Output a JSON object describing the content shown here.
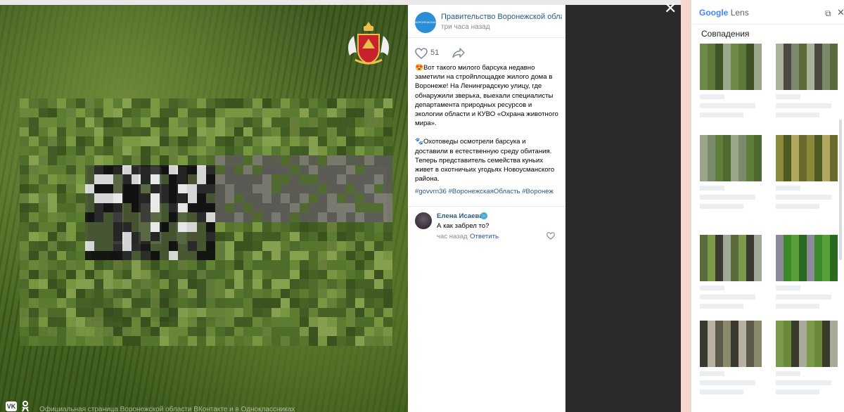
{
  "post": {
    "author": "Правительство Воронежской области",
    "time": "три часа назад",
    "likes": "51",
    "emoji1": "😍",
    "text1": "Вот такого милого барсука недавно заметили на стройплощадке жилого дома в Воронеже! На Ленинградскую улицу, где обнаружили зверька, выехали специалисты департамента природных ресурсов и экологии области и КУВО «Охрана животного мира».",
    "emoji2": "🐾",
    "text2": "Охотоведы осмотрели барсука и доставили в естественную среду обитания. Теперь представитель семейства куньих живет в охотничьих угодьях Новоусманского района.",
    "tags": "#govvrn36 #ВоронежскаяОбласть #Воронеж"
  },
  "comment": {
    "author": "Елена Исаева",
    "text": "А как забрел то?",
    "time": "час назад",
    "reply": "Ответить"
  },
  "photo": {
    "caption": "Официальная страница Воронежской области ВКонтакте и в Одноклассниках",
    "vk_label": "VK",
    "ok_label": "ОК"
  },
  "viewer": {
    "close_label": "✕"
  },
  "lens": {
    "brand_google": "Google",
    "brand_lens": "Lens",
    "section_title": "Совпадения",
    "open_label": "⧉",
    "close_label": "✕"
  },
  "colors": {
    "link": "#2a5885",
    "accent": "#2b8fd6",
    "muted": "#818c99"
  },
  "icons": [
    "close-icon",
    "heart-icon",
    "share-icon",
    "crest-icon",
    "vk-icon",
    "ok-icon",
    "open-in-new-icon"
  ]
}
